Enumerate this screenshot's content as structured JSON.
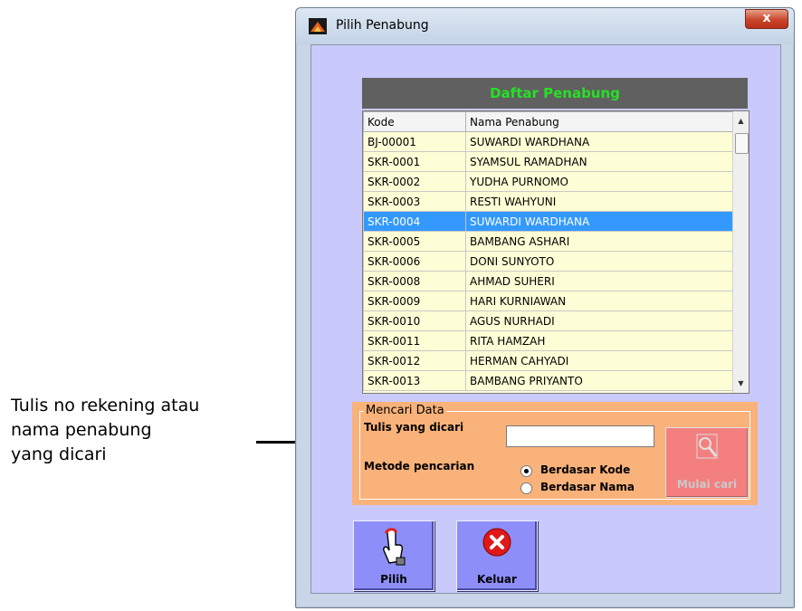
{
  "annotation": {
    "text": "Tulis no rekening atau\nnama penabung\nyang dicari"
  },
  "window": {
    "title": "Pilih Penabung",
    "close_label": "x"
  },
  "list": {
    "title": "Daftar Penabung",
    "columns": [
      "Kode",
      "Nama Penabung"
    ],
    "selected_row": 4,
    "rows": [
      [
        "BJ-00001",
        "SUWARDI WARDHANA"
      ],
      [
        "SKR-0001",
        "SYAMSUL RAMADHAN"
      ],
      [
        "SKR-0002",
        "YUDHA PURNOMO"
      ],
      [
        "SKR-0003",
        "RESTI WAHYUNI"
      ],
      [
        "SKR-0004",
        "SUWARDI WARDHANA"
      ],
      [
        "SKR-0005",
        "BAMBANG ASHARI"
      ],
      [
        "SKR-0006",
        "DONI SUNYOTO"
      ],
      [
        "SKR-0008",
        "AHMAD SUHERI"
      ],
      [
        "SKR-0009",
        "HARI KURNIAWAN"
      ],
      [
        "SKR-0010",
        "AGUS NURHADI"
      ],
      [
        "SKR-0011",
        "RITA HAMZAH"
      ],
      [
        "SKR-0012",
        "HERMAN CAHYADI"
      ],
      [
        "SKR-0013",
        "BAMBANG PRIYANTO"
      ]
    ]
  },
  "search": {
    "group_label": "Mencari Data",
    "input_label": "Tulis yang dicari",
    "input_value": "",
    "method_label": "Metode pencarian",
    "options": [
      "Berdasar Kode",
      "Berdasar Nama"
    ],
    "selected_option": 0,
    "button_label": "Mulai cari"
  },
  "actions": {
    "pilih_label": "Pilih",
    "keluar_label": "Keluar"
  },
  "colors": {
    "window_bg": "#c9d6e8",
    "client_bg": "#c9c9fb",
    "list_bg": "#fefed6",
    "list_title_bg": "#606060",
    "list_title_fg": "#26e026",
    "selection": "#3399ff",
    "search_bg": "#f9b27a",
    "mulai_bg": "#f47f7f",
    "action_btn_bg": "#8e8ef8"
  }
}
